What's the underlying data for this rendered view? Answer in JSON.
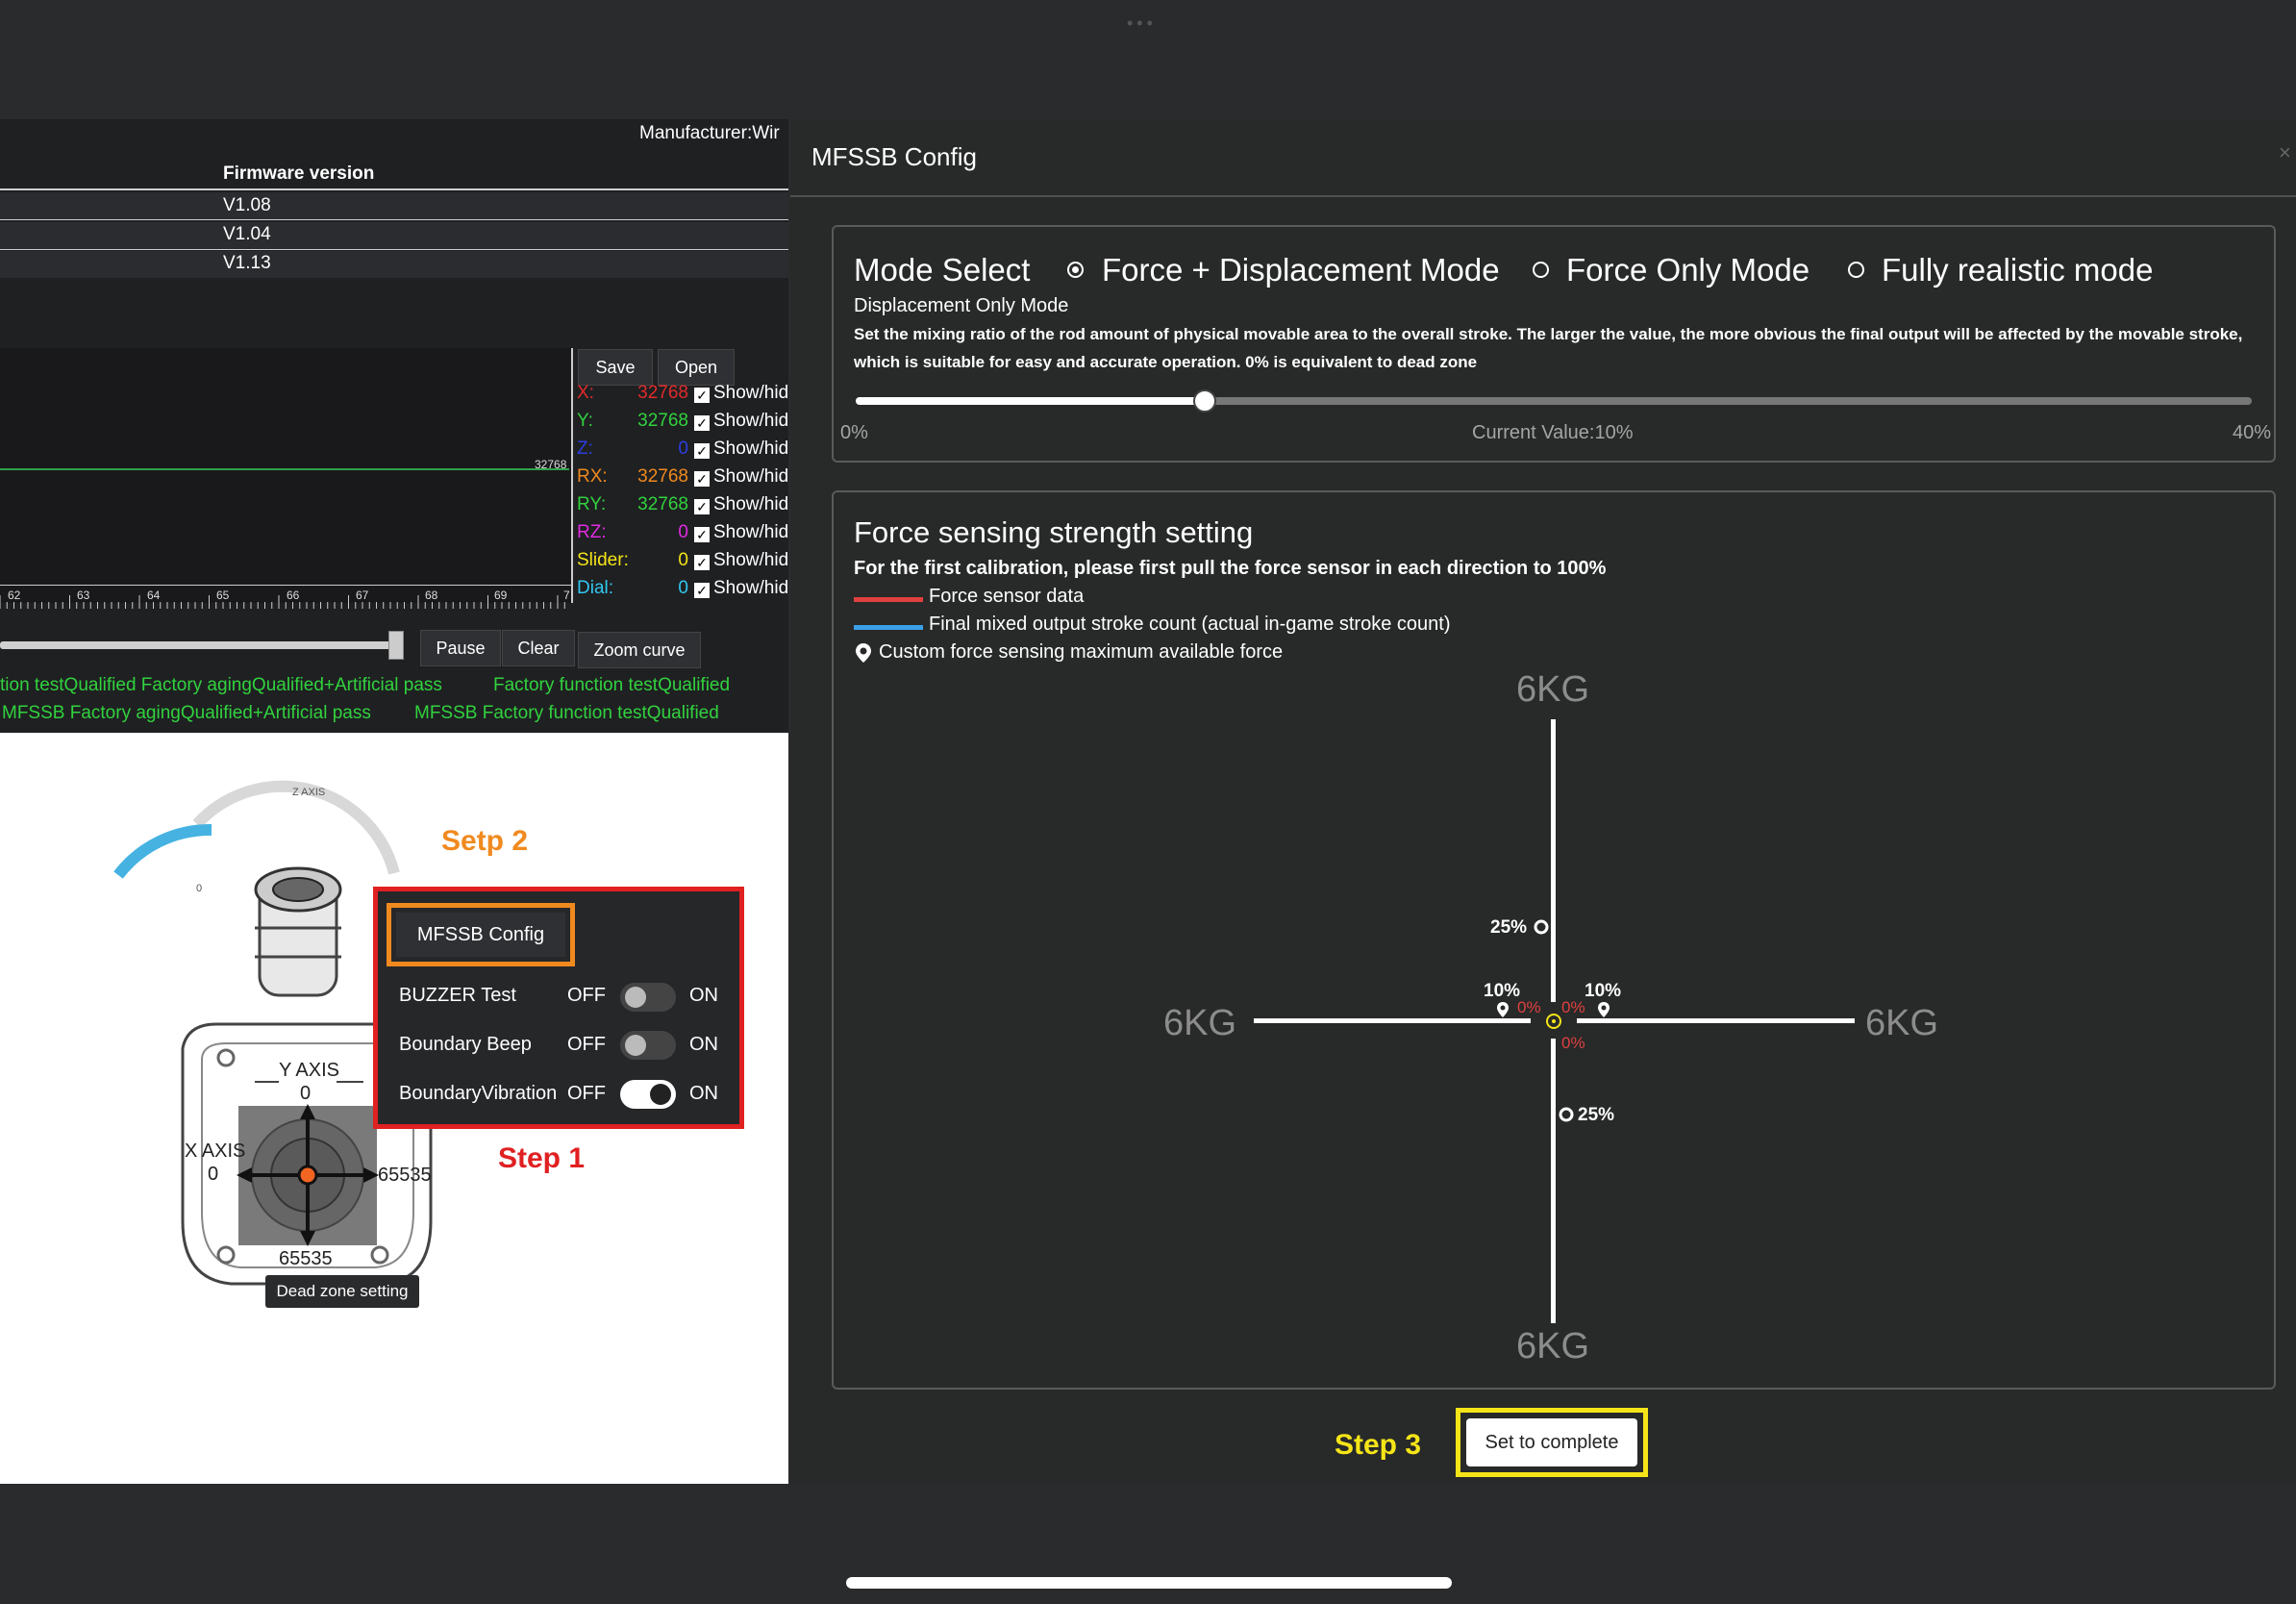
{
  "left": {
    "manufacturer": "Manufacturer:Wir",
    "firmware_header": "Firmware version",
    "firmware_versions": [
      "V1.08",
      "V1.04",
      "V1.13"
    ],
    "chart_mark": "32768",
    "ruler_labels": [
      "62",
      "63",
      "64",
      "65",
      "66",
      "67",
      "68",
      "69",
      "7"
    ],
    "save_label": "Save",
    "open_label": "Open",
    "channels": [
      {
        "key": "X:",
        "value": "32768",
        "color": "#e02a2a"
      },
      {
        "key": "Y:",
        "value": "32768",
        "color": "#31d23e"
      },
      {
        "key": "Z:",
        "value": "0",
        "color": "#2a3ee0"
      },
      {
        "key": "RX:",
        "value": "32768",
        "color": "#f08a1f"
      },
      {
        "key": "RY:",
        "value": "32768",
        "color": "#31d23e"
      },
      {
        "key": "RZ:",
        "value": "0",
        "color": "#e02ae0"
      },
      {
        "key": "Slider:",
        "value": "0",
        "color": "#f5e518"
      },
      {
        "key": "Dial:",
        "value": "0",
        "color": "#31c7f0"
      }
    ],
    "show_hide_label": "Show/hid",
    "pause_label": "Pause",
    "clear_label": "Clear",
    "zoom_label": "Zoom curve",
    "qual_line1a": "tion testQualified Factory agingQualified+Artificial pass",
    "qual_line1b": "Factory function testQualified",
    "qual_line2a": "MFSSB Factory agingQualified+Artificial pass",
    "qual_line2b": "MFSSB Factory function testQualified",
    "z_axis": "Z AXIS",
    "z_zero": "0",
    "y_axis": "Y AXIS",
    "y_zero": "0",
    "x_axis": "X AXIS",
    "x_zero": "0",
    "x_max": "65535",
    "y_max": "65535",
    "dead_zone_label": "Dead zone setting",
    "mfssb_config_button": "MFSSB Config",
    "toggles": [
      {
        "label": "BUZZER Test",
        "off": "OFF",
        "on": "ON",
        "state": false
      },
      {
        "label": "Boundary Beep",
        "off": "OFF",
        "on": "ON",
        "state": false
      },
      {
        "label": "BoundaryVibration",
        "off": "OFF",
        "on": "ON",
        "state": true
      }
    ],
    "step2": "Setp 2",
    "step1": "Step 1"
  },
  "right": {
    "title": "MFSSB Config",
    "close": "×",
    "mode_select": "Mode Select",
    "modes": [
      "Force + Displacement Mode",
      "Force Only Mode",
      "Fully realistic mode"
    ],
    "selected_mode": "Force + Displacement Mode",
    "extra_mode": "Displacement Only Mode",
    "description": "Set the mixing ratio of the rod amount of physical movable area to the overall stroke. The larger the value, the more obvious the final output will be affected by the movable stroke, which is suitable for easy and accurate operation. 0% is equivalent to dead zone",
    "range_min": "0%",
    "range_max": "40%",
    "current_value": "Current Value:10%",
    "force_title": "Force sensing strength setting",
    "force_sub": "For the first calibration, please first pull the force sensor in each direction to 100%",
    "legend": [
      {
        "label": "Force sensor data",
        "color": "#e04040"
      },
      {
        "label": "Final mixed output stroke count (actual in-game stroke count)",
        "color": "#3aa0e8"
      }
    ],
    "custom_force": "Custom force sensing maximum available force",
    "kg_top": "6KG",
    "kg_bottom": "6KG",
    "kg_left": "6KG",
    "kg_right": "6KG",
    "pct_up": "25%",
    "pct_down": "25%",
    "pct_left": "10%",
    "pct_right": "10%",
    "zero_a": "0%",
    "zero_b": "0%",
    "zero_c": "0%",
    "step3": "Step 3",
    "set_complete": "Set to complete"
  }
}
